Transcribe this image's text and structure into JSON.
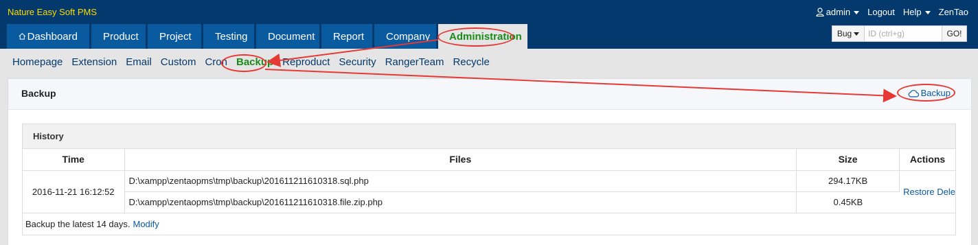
{
  "app": {
    "title": "Nature Easy Soft PMS"
  },
  "topbar": {
    "user": "admin",
    "logout": "Logout",
    "help": "Help",
    "brand": "ZenTao"
  },
  "mainnav": {
    "dashboard": "Dashboard",
    "product": "Product",
    "project": "Project",
    "testing": "Testing",
    "document": "Document",
    "report": "Report",
    "company": "Company",
    "administration": "Administration"
  },
  "search": {
    "type": "Bug",
    "placeholder": "ID (ctrl+g)",
    "go": "GO!"
  },
  "subnav": {
    "homepage": "Homepage",
    "extension": "Extension",
    "email": "Email",
    "custom": "Custom",
    "cron": "Cron",
    "backup": "Backup",
    "reproduct": "Reproduct",
    "security": "Security",
    "rangerteam": "RangerTeam",
    "recycle": "Recycle"
  },
  "panel": {
    "title": "Backup",
    "backup_button": "Backup"
  },
  "history": {
    "title": "History",
    "columns": {
      "time": "Time",
      "files": "Files",
      "size": "Size",
      "actions": "Actions"
    },
    "row": {
      "time": "2016-11-21 16:12:52",
      "file1": "D:\\xampp\\zentaopms\\tmp\\backup\\201611211610318.sql.php",
      "size1": "294.17KB",
      "file2": "D:\\xampp\\zentaopms\\tmp\\backup\\201611211610318.file.zip.php",
      "size2": "0.45KB",
      "restore": "Restore",
      "delete": "Dele"
    },
    "footer": {
      "text": "Backup the latest 14 days.",
      "modify": "Modify"
    }
  },
  "colors": {
    "header": "#03396c",
    "tab": "#0a5aa0",
    "accent_green": "#1a8a1a",
    "annotation_red": "#e53935"
  }
}
